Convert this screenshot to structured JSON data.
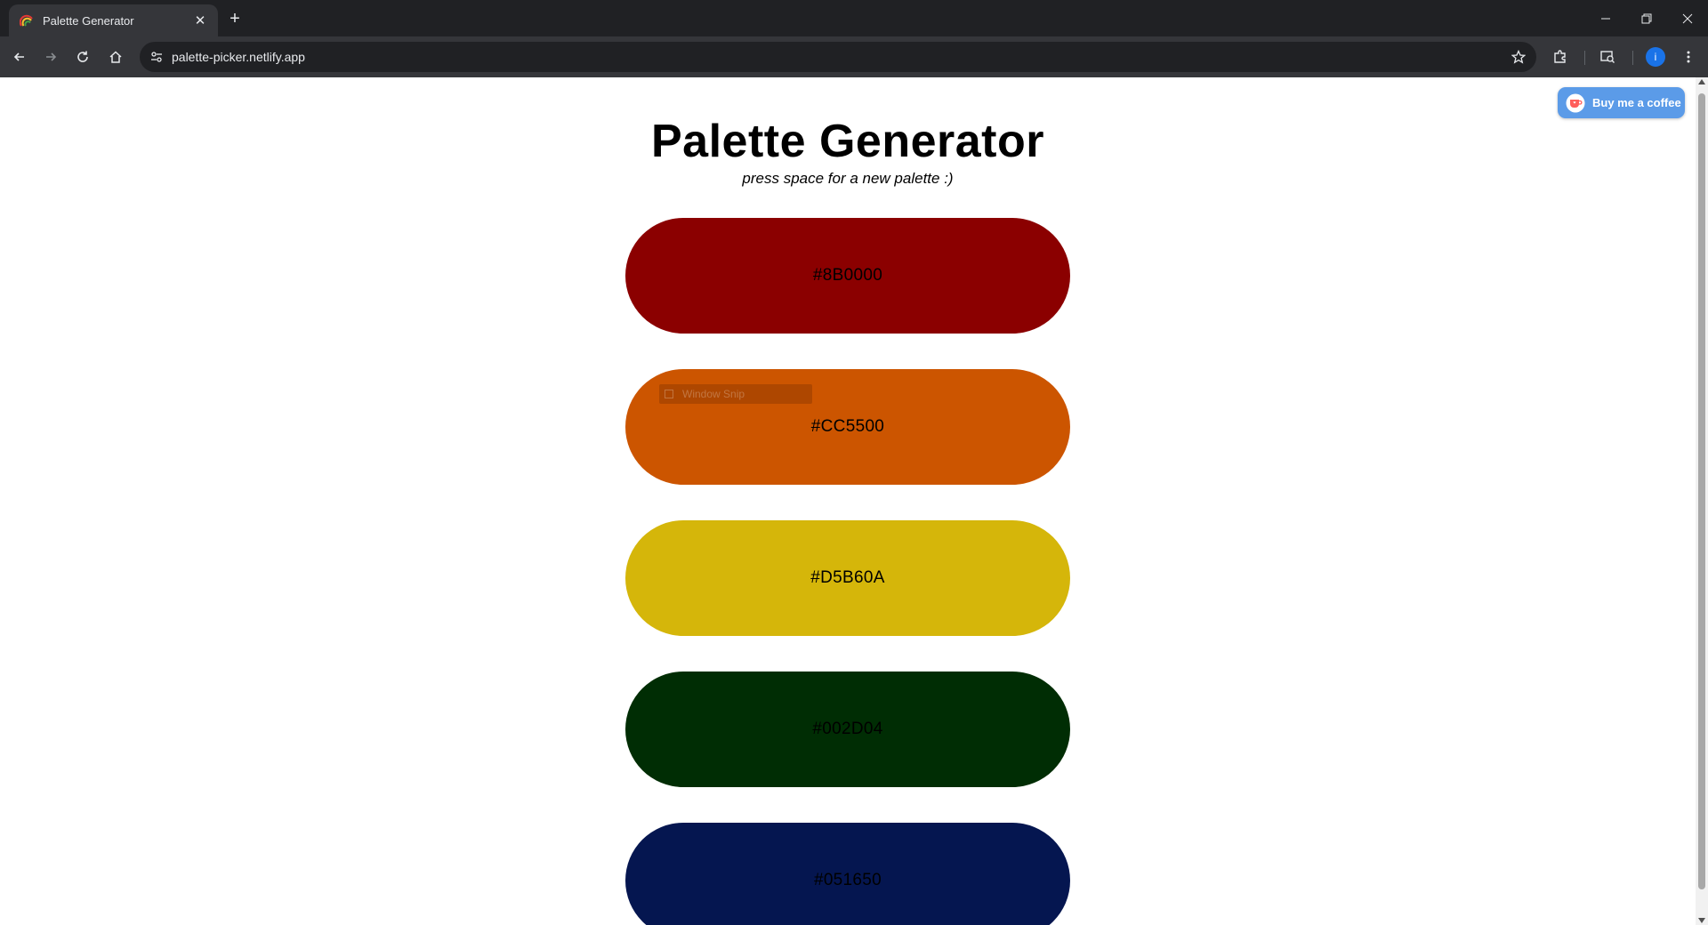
{
  "browser": {
    "tab_title": "Palette Generator",
    "url": "palette-picker.netlify.app",
    "profile_initial": "i"
  },
  "page": {
    "title": "Palette Generator",
    "subtitle": "press space for a new palette :)",
    "coffee_label": "Buy me a coffee",
    "snap_hint": "Window Snip",
    "swatches": [
      {
        "hex": "#8B0000",
        "color": "#8B0000"
      },
      {
        "hex": "#CC5500",
        "color": "#CC5500"
      },
      {
        "hex": "#D5B60A",
        "color": "#D5B60A"
      },
      {
        "hex": "#002D04",
        "color": "#002D04"
      },
      {
        "hex": "#051650",
        "color": "#051650"
      }
    ]
  },
  "colors": {
    "coffee_button": "#5B9BE8",
    "chrome_dark": "#202124",
    "chrome_toolbar": "#35363A"
  }
}
